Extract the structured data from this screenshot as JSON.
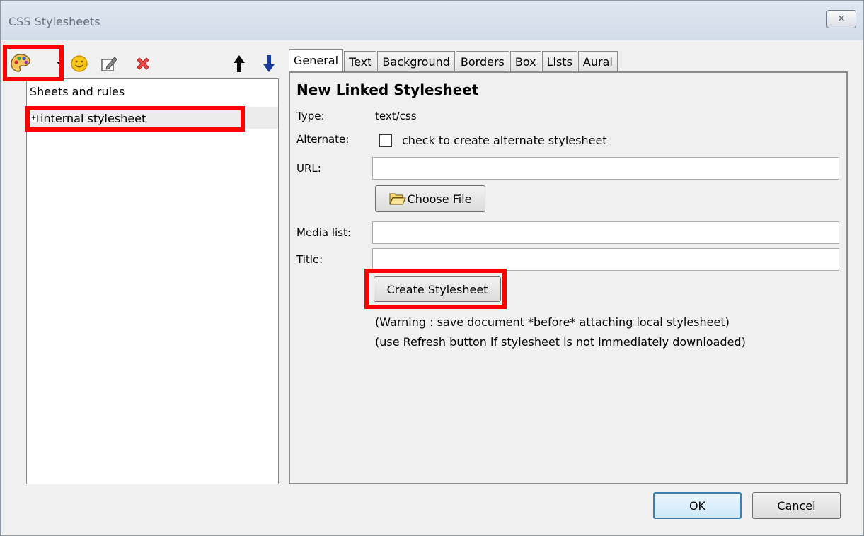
{
  "window": {
    "title": "CSS Stylesheets",
    "close_glyph": "⨯"
  },
  "toolbar": {
    "icons": [
      "palette-icon",
      "dropdown-arrow-icon",
      "smiley-icon",
      "edit-icon",
      "delete-icon",
      "move-up-arrow-icon",
      "move-down-arrow-icon"
    ]
  },
  "left_panel": {
    "header": "Sheets and rules",
    "tree": [
      {
        "label": "internal stylesheet",
        "expander": "+"
      }
    ]
  },
  "tabs": [
    "General",
    "Text",
    "Background",
    "Borders",
    "Box",
    "Lists",
    "Aural"
  ],
  "general": {
    "heading": "New Linked Stylesheet",
    "type_label": "Type:",
    "type_value": "text/css",
    "alternate_label": "Alternate:",
    "alternate_text": "check to create alternate stylesheet",
    "url_label": "URL:",
    "url_value": "",
    "choose_file_label": "Choose File",
    "media_label": "Media list:",
    "media_value": "",
    "title_label": "Title:",
    "title_value": "",
    "create_label": "Create Stylesheet",
    "warning1": "(Warning : save document *before* attaching local stylesheet)",
    "warning2": "(use Refresh button if stylesheet is not immediately downloaded)"
  },
  "buttons": {
    "ok": "OK",
    "cancel": "Cancel"
  },
  "colors": {
    "highlight": "#ff0000",
    "accent_arrow": "#1a3a9c"
  }
}
